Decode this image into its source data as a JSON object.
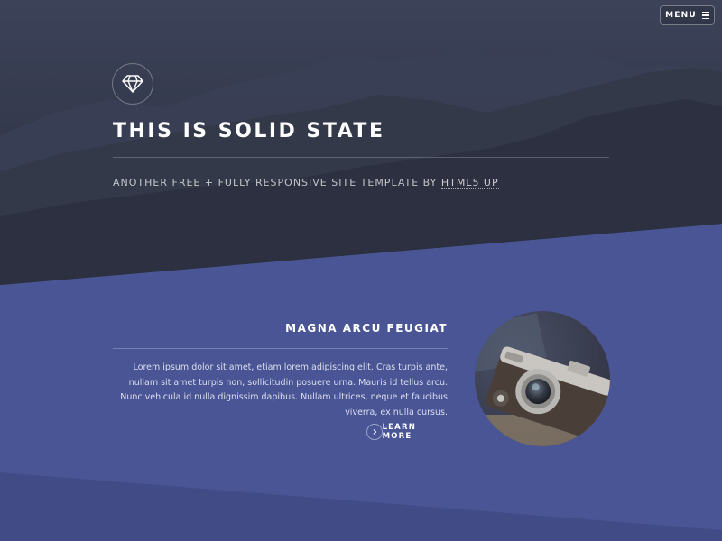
{
  "header": {
    "menu_label": "MENU",
    "menu_icon": "hamburger-icon"
  },
  "banner": {
    "logo_icon": "diamond-icon",
    "title": "THIS IS SOLID STATE",
    "subtitle_prefix": "ANOTHER FREE + FULLY RESPONSIVE SITE TEMPLATE BY ",
    "subtitle_link": "HTML5 UP"
  },
  "feature": {
    "title": "MAGNA ARCU FEUGIAT",
    "body": "Lorem ipsum dolor sit amet, etiam lorem adipiscing elit. Cras turpis ante, nullam sit amet turpis non, sollicitudin posuere urna. Mauris id tellus arcu. Nunc vehicula id nulla dignissim dapibus. Nullam ultrices, neque et faucibus viverra, ex nulla cursus.",
    "button_label": "LEARN MORE",
    "button_icon": "chevron-right-icon",
    "image": "camera-photo"
  },
  "colors": {
    "header_bg": "#2f3446",
    "section_bg": "#4a5596",
    "lower_band": "#414b85",
    "text": "#ffffff"
  }
}
